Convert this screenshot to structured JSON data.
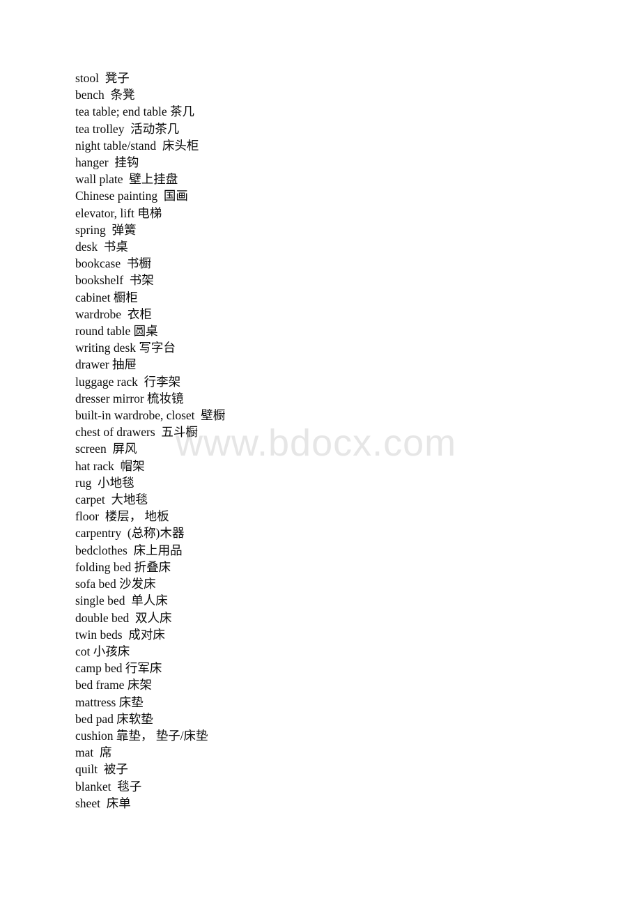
{
  "document": {
    "background_color": "#ffffff",
    "text_color": "#0a0a0a",
    "watermark": {
      "text": "www.bdocx.com",
      "color": "#e6e6e6"
    },
    "lines": [
      "stool  凳子",
      "bench  条凳",
      "tea table; end table 茶几",
      "tea trolley  活动茶几",
      "night table/stand  床头柜",
      "hanger  挂钩",
      "wall plate  壁上挂盘",
      "Chinese painting  国画",
      "elevator, lift 电梯",
      "spring  弹簧",
      "desk  书桌",
      "bookcase  书橱",
      "bookshelf  书架",
      "cabinet 橱柜",
      "wardrobe  衣柜",
      "round table 圆桌",
      "writing desk 写字台",
      "drawer 抽屉",
      "luggage rack  行李架",
      "dresser mirror 梳妆镜",
      "built-in wardrobe, closet  壁橱",
      "chest of drawers  五斗橱",
      "screen  屏风",
      "hat rack  帽架",
      "rug  小地毯",
      "carpet  大地毯",
      "floor  楼层， 地板",
      "carpentry  (总称)木器",
      "bedclothes  床上用品",
      "folding bed 折叠床",
      "sofa bed 沙发床",
      "single bed  单人床",
      "double bed  双人床",
      "twin beds  成对床",
      "cot 小孩床",
      "camp bed 行军床",
      "bed frame 床架",
      "mattress 床垫",
      "bed pad 床软垫",
      "cushion 靠垫， 垫子/床垫",
      "mat  席",
      "quilt  被子",
      "blanket  毯子",
      "sheet  床单"
    ]
  }
}
